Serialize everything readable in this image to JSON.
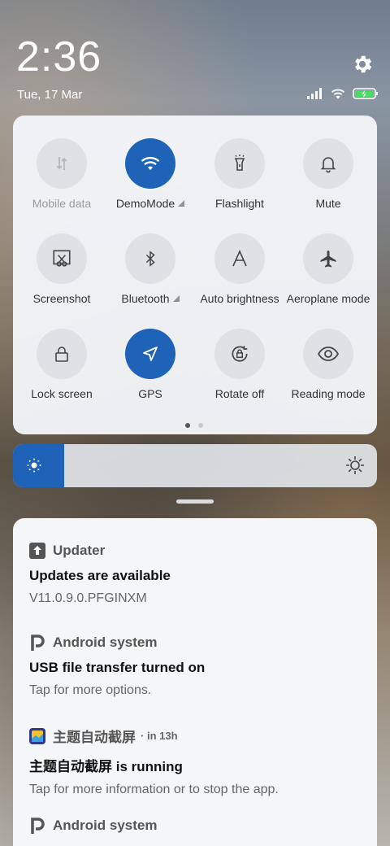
{
  "status_bar": {
    "time": "2:36",
    "date": "Tue, 17 Mar",
    "icons": [
      "signal-icon",
      "wifi-icon",
      "battery-charging-icon"
    ]
  },
  "quick_settings": {
    "tiles": [
      {
        "label": "Mobile data",
        "icon": "mobile-data-icon",
        "active": false,
        "disabled": true
      },
      {
        "label": "DemoMode",
        "icon": "wifi-icon",
        "active": true,
        "expandable": true
      },
      {
        "label": "Flashlight",
        "icon": "flashlight-icon",
        "active": false
      },
      {
        "label": "Mute",
        "icon": "bell-icon",
        "active": false
      },
      {
        "label": "Screenshot",
        "icon": "screenshot-icon",
        "active": false
      },
      {
        "label": "Bluetooth",
        "icon": "bluetooth-icon",
        "active": false,
        "expandable": true
      },
      {
        "label": "Auto brightness",
        "icon": "auto-brightness-icon",
        "active": false
      },
      {
        "label": "Aeroplane mode",
        "icon": "airplane-icon",
        "active": false
      },
      {
        "label": "Lock screen",
        "icon": "lock-icon",
        "active": false
      },
      {
        "label": "GPS",
        "icon": "location-arrow-icon",
        "active": true
      },
      {
        "label": "Rotate off",
        "icon": "rotate-lock-icon",
        "active": false
      },
      {
        "label": "Reading mode",
        "icon": "eye-icon",
        "active": false
      }
    ],
    "page_count": 2,
    "current_page": 1
  },
  "brightness": {
    "level": 0.14
  },
  "notifications": [
    {
      "app": "Updater",
      "icon": "updater-icon",
      "title": "Updates are available",
      "text": "V11.0.9.0.PFGINXM",
      "time": ""
    },
    {
      "app": "Android system",
      "icon": "android-system-icon",
      "title": "USB file transfer turned on",
      "text": "Tap for more options.",
      "time": ""
    },
    {
      "app": "主题自动截屏",
      "icon": "theme-app-icon",
      "title": "主题自动截屏 is running",
      "text": "Tap for more information or to stop the app.",
      "time": "in 13h"
    },
    {
      "app": "Android system",
      "icon": "android-system-icon",
      "title": "",
      "text": "",
      "time": ""
    }
  ],
  "colors": {
    "accent": "#1f63b8",
    "tile_bg": "#dfe1e5",
    "panel_bg": "#f3f5f8"
  }
}
